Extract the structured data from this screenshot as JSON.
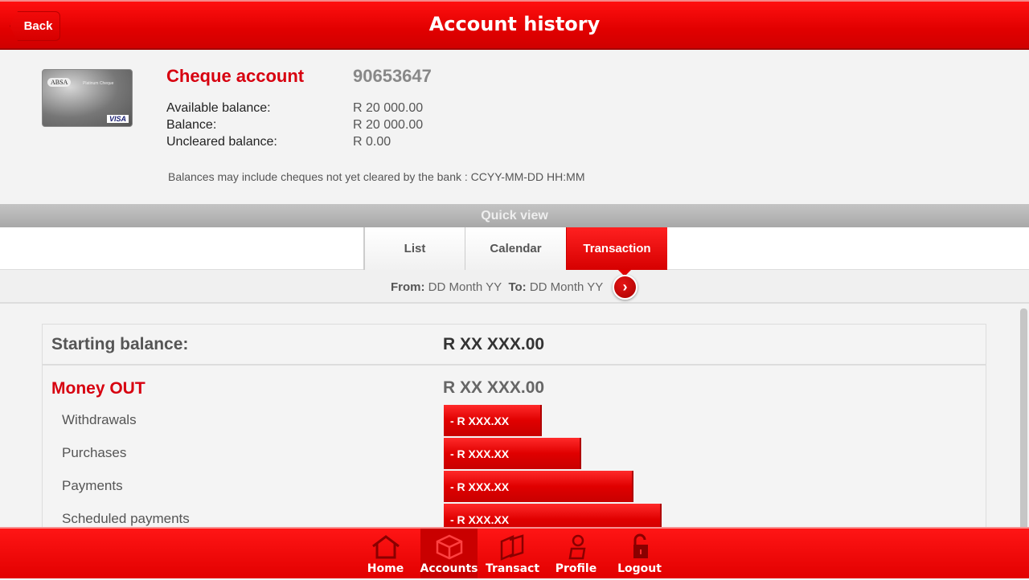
{
  "header": {
    "title": "Account history",
    "back_label": "Back"
  },
  "account": {
    "card": {
      "brand": "ABSA",
      "type": "Platinum Cheque",
      "network": "VISA"
    },
    "name": "Cheque account",
    "number": "90653647",
    "balances": [
      {
        "label": "Available balance:",
        "value": "R 20 000.00"
      },
      {
        "label": "Balance:",
        "value": "R 20 000.00"
      },
      {
        "label": "Uncleared balance:",
        "value": "R 0.00"
      }
    ],
    "note": "Balances may include cheques not yet cleared by the bank : CCYY-MM-DD HH:MM"
  },
  "quick_view": {
    "title": "Quick view",
    "tabs": [
      {
        "label": "List",
        "active": false
      },
      {
        "label": "Calendar",
        "active": false
      },
      {
        "label": "Transaction",
        "active": true
      }
    ],
    "date_range": {
      "from_label": "From:",
      "from_value": "DD Month YY",
      "to_label": "To:",
      "to_value": "DD Month YY"
    }
  },
  "summary": {
    "starting_balance_label": "Starting balance:",
    "starting_balance_value": "R XX XXX.00",
    "money_out_label": "Money OUT",
    "money_out_value": "R XX XXX.00",
    "rows": [
      {
        "label": "Withdrawals",
        "value": "- R XXX.XX",
        "relative_size": 0.45
      },
      {
        "label": "Purchases",
        "value": "- R XXX.XX",
        "relative_size": 0.63
      },
      {
        "label": "Payments",
        "value": "- R XXX.XX",
        "relative_size": 0.87
      },
      {
        "label": "Scheduled payments",
        "value": "- R XXX.XX",
        "relative_size": 1.0
      }
    ]
  },
  "nav": [
    {
      "label": "Home",
      "icon": "home-icon",
      "active": false
    },
    {
      "label": "Accounts",
      "icon": "cube-icon",
      "active": true
    },
    {
      "label": "Transact",
      "icon": "transact-icon",
      "active": false
    },
    {
      "label": "Profile",
      "icon": "profile-icon",
      "active": false
    },
    {
      "label": "Logout",
      "icon": "padlock-icon",
      "active": false
    }
  ]
}
